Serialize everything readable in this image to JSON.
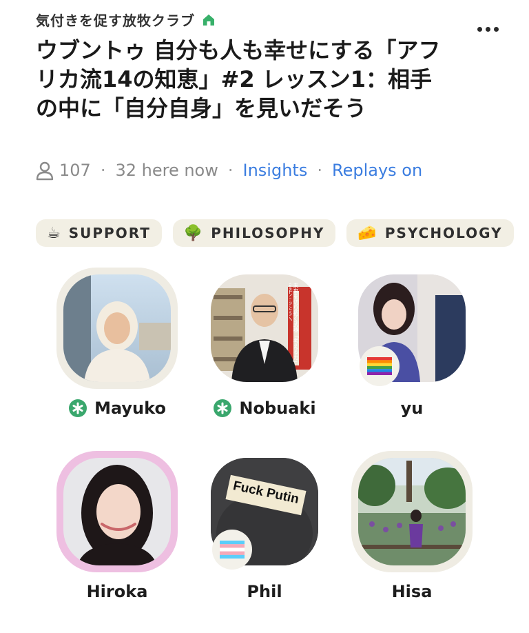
{
  "club": {
    "name": "気付きを促す放牧クラブ",
    "icon": "house-icon",
    "icon_color": "#38b06a"
  },
  "room": {
    "title": "ウブントゥ 自分も人も幸せにする「アフリカ流14の知恵」#2 レッスン1：相手の中に「自分自身」を見いだそう",
    "listener_count": "107",
    "here_now": "32 here now",
    "insights_label": "Insights",
    "replays_label": "Replays on"
  },
  "topics": [
    {
      "emoji": "☕",
      "label": "SUPPORT"
    },
    {
      "emoji": "🌳",
      "label": "PHILOSOPHY"
    },
    {
      "emoji": "🧀",
      "label": "PSYCHOLOGY"
    }
  ],
  "speakers": [
    {
      "name": "Mayuko",
      "moderator": true,
      "badge": null
    },
    {
      "name": "Nobuaki",
      "moderator": true,
      "badge": null,
      "poster_text": "未来を切り拓く武器「考える力」を子どもたちへ"
    },
    {
      "name": "yu",
      "moderator": false,
      "badge": "rainbow-flag"
    },
    {
      "name": "Hiroka",
      "moderator": false,
      "badge": null
    },
    {
      "name": "Phil",
      "moderator": false,
      "badge": "transgender-flag",
      "sign_text": "Fuck Putin"
    },
    {
      "name": "Hisa",
      "moderator": false,
      "badge": null
    }
  ],
  "colors": {
    "accent_link": "#3b7de0",
    "moderator_green": "#3aa76d",
    "chip_bg": "#f2efe4"
  }
}
